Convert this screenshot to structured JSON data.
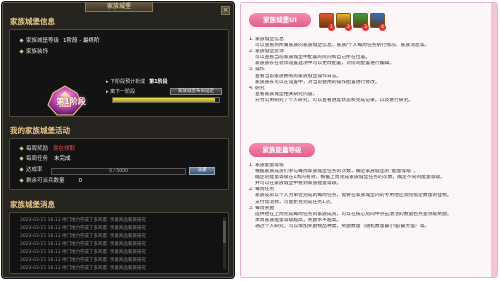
{
  "window": {
    "title": "家族城堡",
    "close": "×"
  },
  "info": {
    "title": "家族城堡信息",
    "level_label": "家族城堡等级",
    "level_value": "1阶段 - 最终阶",
    "decor_label": "家族装饰",
    "next_label": "下阶段预计析成",
    "next_value": "第1阶段",
    "cur_label": "离下一阶段",
    "stage_label": "第1阶段",
    "config_button": "家族城堡布局设定",
    "progress": 0.96
  },
  "activity": {
    "title": "我的家族城堡活动",
    "rows": [
      {
        "label": "每周奖励",
        "value": "现在领取"
      },
      {
        "label": "每周任务",
        "value": "未完成"
      },
      {
        "label": "达成率",
        "value": ""
      },
      {
        "label": "剩余可派兵数量",
        "value": "0"
      }
    ],
    "progress_text": "0 / 5000",
    "apply_button": "派遣"
  },
  "messages": {
    "title": "家族城堡消息",
    "items": [
      "2023-03-15 16:13 地门地力完成了多邦度: 亲爱商品家族研究",
      "2023-03-15 16:13 地门地力完成了多邦度: 亲爱商品家族研究",
      "2023-03-15 16:13 地门地力完成了多邦度: 亲爱商品家族研究",
      "2023-03-15 16:13 地门地力完成了多邦度: 亲爱商品家族研究",
      "2023-03-15 16:13 地门地力完成了多邦度: 亲爱商品家族研究",
      "2023-03-15 16:13 地门地力完成了多邦度: 亲爱商品家族研究",
      "2023-03-15 16:13 地门地力完成了多邦度: 亲爱商品家族研究"
    ]
  },
  "help": {
    "ui_header": "家族城堡UI",
    "icons": [
      {
        "num": "1",
        "color": "#e25a2a"
      },
      {
        "num": "2",
        "color": "#f0b428"
      },
      {
        "num": "3",
        "color": "#3a9c3c"
      },
      {
        "num": "4",
        "color": "#2e6fc2"
      }
    ],
    "ui_lines": [
      "1. 家族城堡信息",
      "可以查看到所属家族的家族城堡信息、家族/个人每周任务执行情况、家族消息等。",
      "2. 家族城堡装饰",
      "可以查看当前家族城堡中配置的房间和自己所在位置。",
      "家族族长在装饰设置选项中可以更改配置，对房间配置进行编辑。",
      "3. 操作",
      "查看当前家族拥有的家族城堡操作日志。",
      "家族族长可以在设置中，对当前使用的操作配置进行修改。",
      "4. 研究",
      "查看家族城堡相关研究内容。",
      "分为公用研究 / 个人研究，可以查看进度状态和完成记录，以及进行研究。"
    ],
    "rank_header": "家族能量等级",
    "rank_lines": [
      "1. 家族能量等级",
      "根据家族成员们参与每周家族城堡任务的次数，确定家族城堡的“能量等级”。",
      "确定的能量等级在1周内有效，根据上周完成家族城堡任务的次数，确定不同的能量等级。",
      "并可以在家族城堡中看到家族能量等级。",
      "2. 每周任务",
      "家族成员以个人为单位完成的每周任务，需要在家族城堡内的专用地区调完指定数量的怪物。",
      "支付现消费，可能折兑完成任务1次。",
      "3. 每周奖励",
      "提供给在上周完成每周任务的家族成员，可以在核心房间中点击激活的数量右点查领取奖励。",
      "本周家族能量等级越高，奖励水平越高。",
      "通过个人研究，可以增加奖励物品种类、奖励数量（随机数量最小值/最大值）等。"
    ]
  }
}
